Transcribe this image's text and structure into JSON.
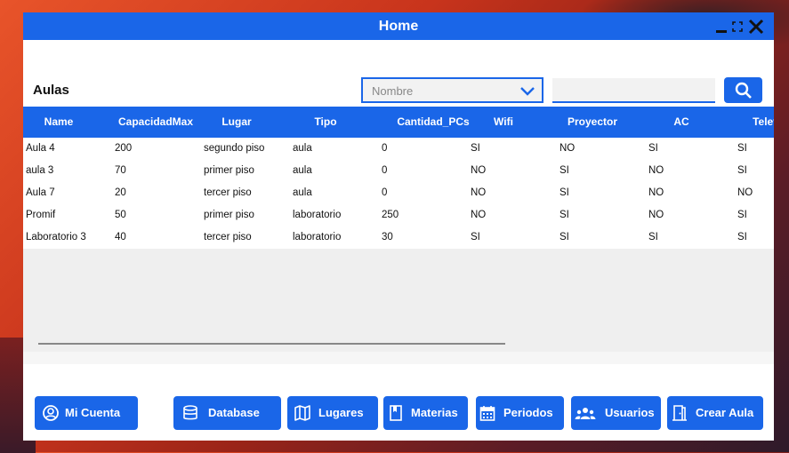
{
  "window": {
    "title": "Home"
  },
  "section": {
    "title": "Aulas"
  },
  "filter": {
    "selected": "Nombre"
  },
  "search": {
    "value": "",
    "placeholder": ""
  },
  "table": {
    "columns": [
      "Name",
      "CapacidadMax",
      "Lugar",
      "Tipo",
      "Cantidad_PCs",
      "Wifi",
      "Proyector",
      "AC",
      "Telev"
    ],
    "rows": [
      [
        "Aula 4",
        "200",
        "segundo piso",
        "aula",
        "0",
        "SI",
        "NO",
        "SI",
        "SI"
      ],
      [
        "aula 3",
        "70",
        "primer piso",
        "aula",
        "0",
        "NO",
        "SI",
        "NO",
        "SI"
      ],
      [
        "Aula 7",
        "20",
        "tercer piso",
        "aula",
        "0",
        "NO",
        "SI",
        "NO",
        "NO"
      ],
      [
        "Promif",
        "50",
        "primer piso",
        "laboratorio",
        "250",
        "NO",
        "SI",
        "NO",
        "SI"
      ],
      [
        "Laboratorio 3",
        "40",
        "tercer piso",
        "laboratorio",
        "30",
        "SI",
        "SI",
        "SI",
        "SI"
      ]
    ]
  },
  "nav": {
    "mi_cuenta": "Mi Cuenta",
    "database": "Database",
    "lugares": "Lugares",
    "materias": "Materias",
    "periodos": "Periodos",
    "usuarios": "Usuarios",
    "crear_aula": "Crear Aula"
  },
  "colors": {
    "accent": "#1a66e8",
    "table_bg": "#efefef"
  }
}
